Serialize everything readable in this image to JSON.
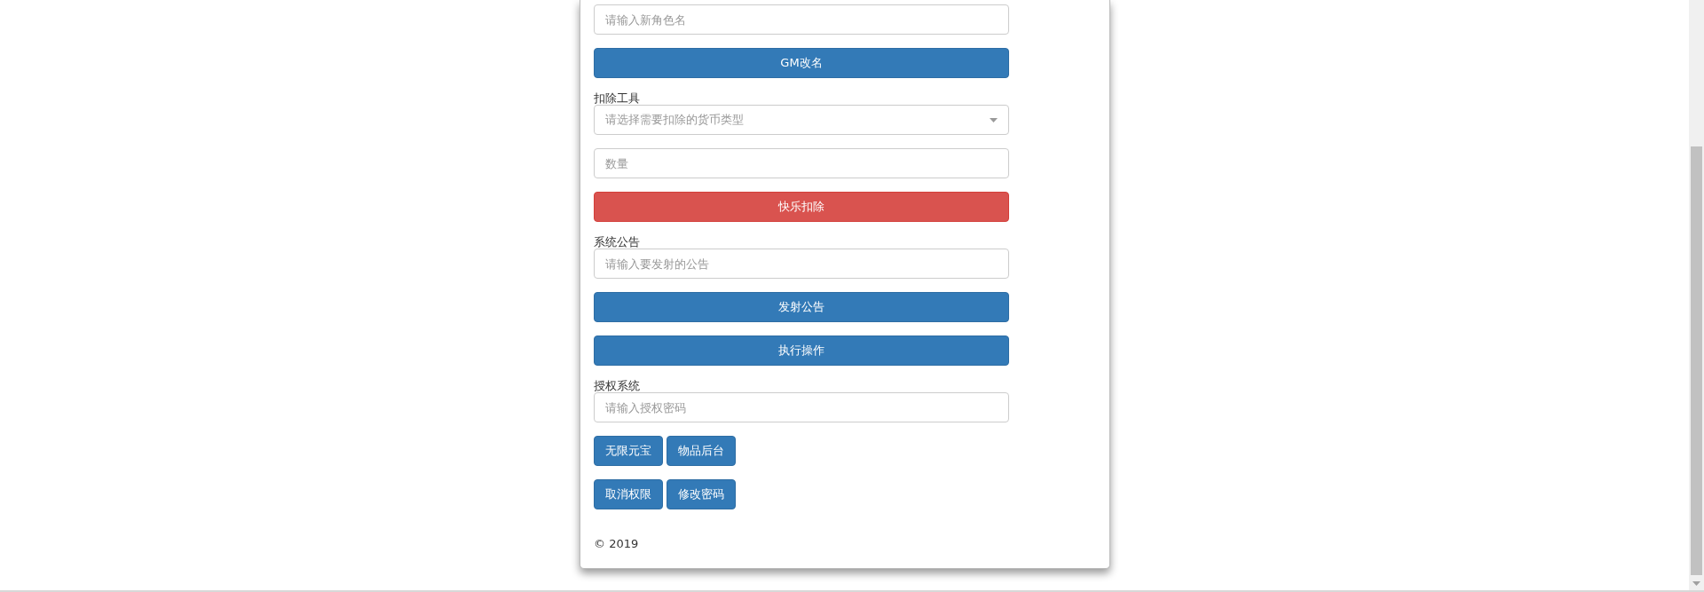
{
  "form": [
    {
      "kind": "input",
      "placeholder": "请输入新角色名"
    },
    {
      "kind": "button",
      "label": "GM改名"
    },
    {
      "kind": "label",
      "text": "扣除工具"
    },
    {
      "kind": "select",
      "placeholder": "请选择需要扣除的货币类型"
    },
    {
      "kind": "input",
      "placeholder": "数量"
    },
    {
      "kind": "danger_button",
      "label": "快乐扣除"
    },
    {
      "kind": "label",
      "text": "系统公告"
    },
    {
      "kind": "input",
      "placeholder": "请输入要发射的公告"
    },
    {
      "kind": "button",
      "label": "发射公告"
    },
    {
      "kind": "button",
      "label": "执行操作"
    },
    {
      "kind": "label",
      "text": "授权系统"
    },
    {
      "kind": "input",
      "placeholder": "请输入授权密码"
    },
    {
      "kind": "button_row",
      "buttons": [
        "无限元宝",
        "物品后台"
      ]
    },
    {
      "kind": "button_row",
      "buttons": [
        "取消权限",
        "修改密码"
      ]
    }
  ],
  "footer": "© 2019"
}
